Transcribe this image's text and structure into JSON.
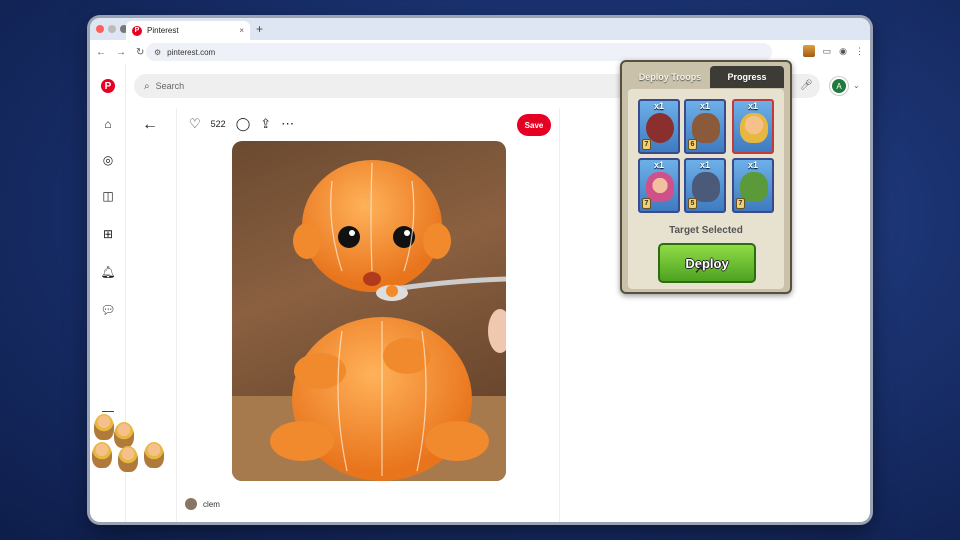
{
  "browser": {
    "tab_title": "Pinterest",
    "tab_favicon": "P",
    "url": "pinterest.com",
    "new_tab_glyph": "+",
    "close_glyph": "×"
  },
  "pinterest": {
    "search_placeholder": "Search",
    "like_count": "522",
    "save_label": "Save",
    "author_name": "clem",
    "logo_letter": "P",
    "avatar_letter": "A"
  },
  "extension": {
    "tab_deploy": "Deploy Troops",
    "tab_progress": "Progress",
    "target_text": "Target Selected",
    "deploy_label": "Deploy",
    "troops": [
      {
        "count": "x1",
        "level": "7",
        "name": "balloon"
      },
      {
        "count": "x1",
        "level": "6",
        "name": "hog-rider"
      },
      {
        "count": "x1",
        "level": "",
        "name": "barbarian"
      },
      {
        "count": "x1",
        "level": "7",
        "name": "archer"
      },
      {
        "count": "x1",
        "level": "5",
        "name": "golem"
      },
      {
        "count": "x1",
        "level": "7",
        "name": "goblin"
      }
    ]
  },
  "colors": {
    "pinterest_red": "#e60023",
    "deploy_green": "#5cb830",
    "popup_bg": "#c9c1a9"
  }
}
